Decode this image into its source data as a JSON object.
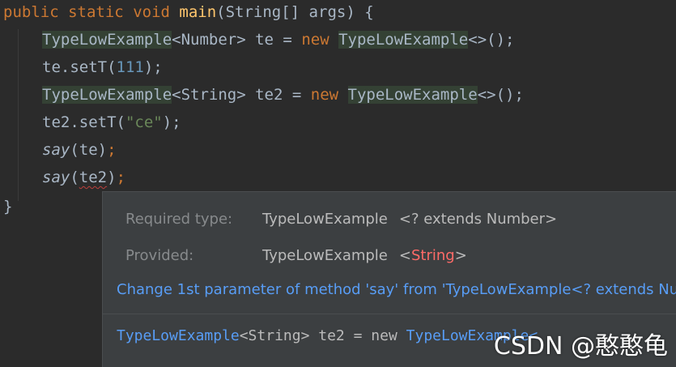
{
  "code": {
    "line1": {
      "kw1": "public",
      "kw2": "static",
      "kw3": "void",
      "method": "main",
      "params": "(String[] args) {"
    },
    "line2": {
      "type": "TypeLowExample",
      "generic": "<Number>",
      "var": " te = ",
      "kw": "new",
      "ctor": "TypeLowExample",
      "end": "<>();"
    },
    "line3": {
      "call": "te.setT(",
      "num": "111",
      "end": ");"
    },
    "line4": {
      "type": "TypeLowExample",
      "generic": "<String>",
      "var": " te2 = ",
      "kw": "new",
      "ctor": "TypeLowExample",
      "end": "<>();"
    },
    "line5": {
      "call": "te2.setT(",
      "str": "\"ce\"",
      "end": ");"
    },
    "line6": {
      "fn": "say",
      "args": "(te)",
      "end": ";"
    },
    "line7": {
      "fn": "say",
      "open": "(",
      "arg": "te2",
      "close": ")",
      "end": ";"
    },
    "line8": {
      "brace": "}"
    }
  },
  "popup": {
    "required_label": "Required type:",
    "required_type": "TypeLowExample",
    "required_generic": "<? extends Number>",
    "provided_label": "Provided:",
    "provided_type": "TypeLowExample",
    "provided_open": "<",
    "provided_generic": "String",
    "provided_close": ">",
    "fix_text": "Change 1st parameter of method 'say' from 'TypeLowExample<? extends Nu",
    "preview_type": "TypeLowExample",
    "preview_generic": "<String>",
    "preview_rest": " te2 = new ",
    "preview_ctor": "TypeLowExample<"
  },
  "watermark": "CSDN @憨憨龟",
  "colors": {
    "background": "#2b2b2b",
    "popup": "#3c3f41",
    "keyword": "#cc7832",
    "method": "#ffc66d",
    "number": "#6897bb",
    "string": "#6a8759",
    "link": "#589df6",
    "error": "#ff6b68"
  }
}
